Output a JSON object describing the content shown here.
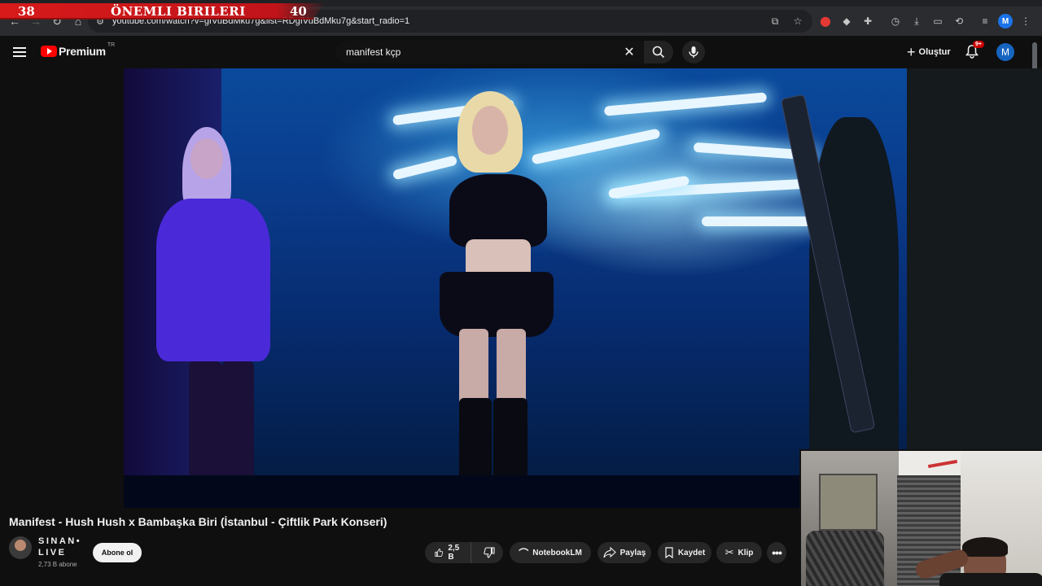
{
  "overlay": {
    "left_number": "38",
    "title": "ÖNEMLI BIRILERI",
    "right_number": "40"
  },
  "browser": {
    "url": "youtube.com/watch?v=gIVuBdMku7g&list=RDgIVuBdMku7g&start_radio=1",
    "avatar_letter": "M"
  },
  "header": {
    "logo_text": "Premium",
    "logo_region": "TR",
    "search_value": "manifest kçp",
    "create_label": "Oluştur",
    "notification_badge": "9+",
    "avatar_letter": "M"
  },
  "video": {
    "title": "Manifest - Hush Hush x Bambaşka Biri (İstanbul - Çiftlik Park Konseri)",
    "channel_name": "SINAN• LIVE",
    "subscriber_count": "2,73 B abone",
    "subscribe_label": "Abone ol",
    "like_count": "2,5 B",
    "notebook_label": "NotebookLM",
    "share_label": "Paylaş",
    "save_label": "Kaydet",
    "clip_label": "Klip"
  },
  "colors": {
    "brand_red": "#ff0000",
    "banner_red": "#d81a1a",
    "avatar_blue": "#1565c0"
  }
}
